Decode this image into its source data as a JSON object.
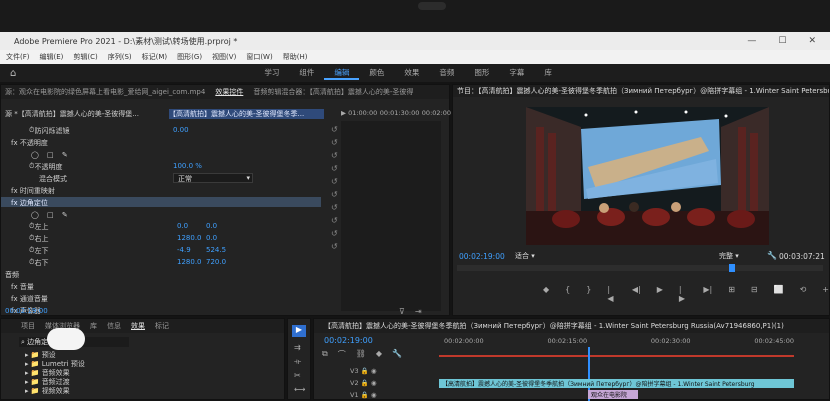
{
  "window": {
    "title": "Adobe Premiere Pro 2021 - D:\\素材\\测试\\转场使用.prproj *",
    "controls": [
      "—",
      "☐",
      "✕"
    ]
  },
  "menu": [
    "文件(F)",
    "编辑(E)",
    "剪辑(C)",
    "序列(S)",
    "标记(M)",
    "图形(G)",
    "视图(V)",
    "窗口(W)",
    "帮助(H)"
  ],
  "workspaces": [
    "学习",
    "组件",
    "编辑",
    "颜色",
    "效果",
    "音频",
    "图形",
    "字幕",
    "库"
  ],
  "active_workspace": "编辑",
  "effects_panel": {
    "tabs": [
      "源：观众在电影院的绿色屏幕上看电影_爱给网_aigei_com.mp4",
      "效果控件",
      "音频剪辑混合器：【高清航拍】震撼人心的美-圣彼得"
    ],
    "active_tab": "效果控件",
    "source_label": "源 *【高清航拍】震撼人心的美-圣彼得堡...",
    "sequence_label": "【高清航拍】震撼人心的美-圣彼得堡冬季...",
    "ruler": [
      "▶ 01:00:00",
      "00:01:30:00",
      "00:02:00"
    ],
    "rows": [
      {
        "label": "防闪烁滤镜",
        "value": "0.00"
      },
      {
        "label": "fx 不透明度",
        "value": ""
      },
      {
        "label": "◯ □ ✎",
        "value": ""
      },
      {
        "label": "不透明度",
        "value": "100.0 %"
      },
      {
        "label": "混合模式",
        "value": "正常"
      },
      {
        "label": "fx 时间重映射",
        "value": ""
      },
      {
        "label": "fx 边角定位",
        "value": ""
      },
      {
        "label": "◯ □ ✎",
        "value": ""
      },
      {
        "label": "左上",
        "value": "0.0",
        "value2": "0.0"
      },
      {
        "label": "右上",
        "value": "1280.0",
        "value2": "0.0"
      },
      {
        "label": "左下",
        "value": "-4.9",
        "value2": "524.5"
      },
      {
        "label": "右下",
        "value": "1280.0",
        "value2": "720.0"
      }
    ],
    "audio_header": "音频",
    "audio_rows": [
      "fx 音量",
      "fx 通道音量",
      "fx 声像器"
    ],
    "timecode": "00:02:19:00"
  },
  "program_monitor": {
    "title": "节目：【高清航拍】震撼人心的美-圣彼得堡冬季航拍（Зимний Петербург）@陪拼字幕组 - 1.Winter Saint Petersburg Russia(Av",
    "timecode": "00:02:19:00",
    "fit": "适合",
    "quality": "完整",
    "duration": "00:03:07:21",
    "transport": [
      "◆",
      "{",
      "}",
      "|◀",
      "◀|",
      "▶",
      "|▶",
      "▶|",
      "⊞",
      "⊟",
      "⬜",
      "⟲",
      "+"
    ]
  },
  "project_panel": {
    "tabs": [
      "项目",
      "媒体浏览器",
      "库",
      "信息",
      "效果",
      "标记"
    ],
    "search_value": "边角定位",
    "tree": [
      "预设",
      "Lumetri 预设",
      "音频效果",
      "音频过渡",
      "视频效果"
    ]
  },
  "timeline": {
    "sequence_name": "【高清航拍】震撼人心的美-圣彼得堡冬季航拍（Зимний Петербург）@陪拼字幕组 - 1.Winter Saint Petersburg Russia(Av71946860,P1)(1)",
    "timecode": "00:02:19:00",
    "ruler": [
      "00:02:00:00",
      "00:02:15:00",
      "00:02:30:00",
      "00:02:45:00"
    ],
    "tracks": [
      "V3",
      "V2",
      "V1"
    ],
    "clip_v1": "【高清航拍】震撼人心的美-圣彼得堡冬季航拍（Зимний Петербург）@陪拼字幕组 - 1.Winter Saint Petersburg",
    "clip_v2": "观众在电影院"
  },
  "colors": {
    "accent": "#3fa0ff",
    "panel": "#232323",
    "playhead": "#2f8fff",
    "clip_v1": "#6ec6d6"
  }
}
